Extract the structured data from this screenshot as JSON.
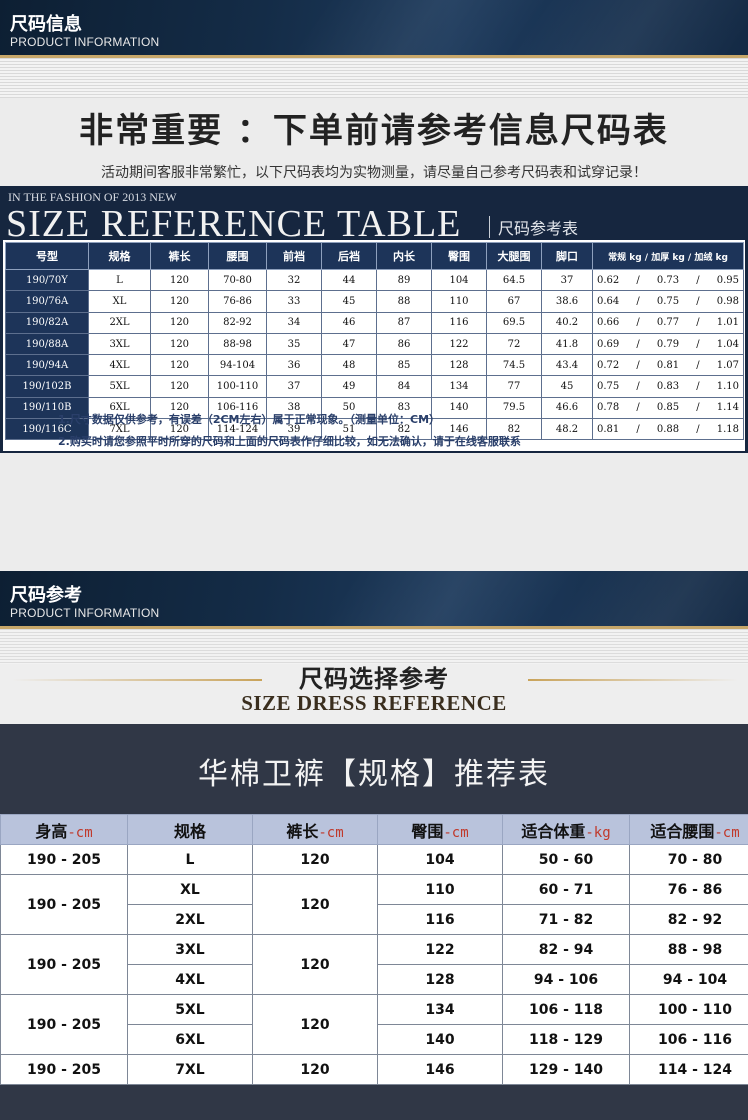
{
  "header1": {
    "cn": "尺码信息",
    "en": "PRODUCT INFORMATION"
  },
  "headline": "非常重要 ：下单前请参考信息尺码表",
  "subline": "活动期间客服非常繁忙，以下尺码表均为实物测量，请尽量自己参考尺码表和试穿记录！",
  "size_ref": {
    "fashion_line": "IN THE FASHION OF 2013 NEW",
    "title": "SIZE REFERENCE TABLE",
    "cn_title": "尺码参考表",
    "headers": [
      "号型",
      "规格",
      "裤长",
      "腰围",
      "前裆",
      "后裆",
      "内长",
      "臀围",
      "大腿围",
      "脚口",
      "常规 kg / 加厚 kg / 加绒 kg"
    ],
    "rows": [
      [
        "190/70Y",
        "L",
        "120",
        "70-80",
        "32",
        "44",
        "89",
        "104",
        "64.5",
        "37",
        "0.62",
        "0.73",
        "0.95"
      ],
      [
        "190/76A",
        "XL",
        "120",
        "76-86",
        "33",
        "45",
        "88",
        "110",
        "67",
        "38.6",
        "0.64",
        "0.75",
        "0.98"
      ],
      [
        "190/82A",
        "2XL",
        "120",
        "82-92",
        "34",
        "46",
        "87",
        "116",
        "69.5",
        "40.2",
        "0.66",
        "0.77",
        "1.01"
      ],
      [
        "190/88A",
        "3XL",
        "120",
        "88-98",
        "35",
        "47",
        "86",
        "122",
        "72",
        "41.8",
        "0.69",
        "0.79",
        "1.04"
      ],
      [
        "190/94A",
        "4XL",
        "120",
        "94-104",
        "36",
        "48",
        "85",
        "128",
        "74.5",
        "43.4",
        "0.72",
        "0.81",
        "1.07"
      ],
      [
        "190/102B",
        "5XL",
        "120",
        "100-110",
        "37",
        "49",
        "84",
        "134",
        "77",
        "45",
        "0.75",
        "0.83",
        "1.10"
      ],
      [
        "190/110B",
        "6XL",
        "120",
        "106-116",
        "38",
        "50",
        "83",
        "140",
        "79.5",
        "46.6",
        "0.78",
        "0.85",
        "1.14"
      ],
      [
        "190/116C",
        "7XL",
        "120",
        "114-124",
        "39",
        "51",
        "82",
        "146",
        "82",
        "48.2",
        "0.81",
        "0.88",
        "1.18"
      ]
    ]
  },
  "notes": [
    "1.尺寸数据仅供参考，有误差（2CM左右）属于正常现象。（测量单位：CM）",
    "2.购买时请您参照平时所穿的尺码和上面的尺码表作仔细比较，如无法确认，请于在线客服联系"
  ],
  "header2": {
    "cn": "尺码参考",
    "en": "PRODUCT INFORMATION"
  },
  "size_select": {
    "cn": "尺码选择参考",
    "en": "SIZE DRESS REFERENCE"
  },
  "recommend": {
    "title": "华棉卫裤【规格】推荐表",
    "headers": [
      {
        "label": "身高",
        "unit": "-cm"
      },
      {
        "label": "规格",
        "unit": ""
      },
      {
        "label": "裤长",
        "unit": "-cm"
      },
      {
        "label": "臀围",
        "unit": "-cm"
      },
      {
        "label": "适合体重",
        "unit": "-kg"
      },
      {
        "label": "适合腰围",
        "unit": "-cm"
      }
    ],
    "groups": [
      {
        "height": "190 - 205",
        "length": "120",
        "rows": [
          {
            "size": "L",
            "hip": "104",
            "weight": "50 - 60",
            "waist": "70 - 80"
          }
        ]
      },
      {
        "height": "190 - 205",
        "length": "120",
        "rows": [
          {
            "size": "XL",
            "hip": "110",
            "weight": "60 - 71",
            "waist": "76 - 86"
          },
          {
            "size": "2XL",
            "hip": "116",
            "weight": "71 - 82",
            "waist": "82 - 92"
          }
        ]
      },
      {
        "height": "190 - 205",
        "length": "120",
        "rows": [
          {
            "size": "3XL",
            "hip": "122",
            "weight": "82 - 94",
            "waist": "88 - 98"
          },
          {
            "size": "4XL",
            "hip": "128",
            "weight": "94 - 106",
            "waist": "94 - 104"
          }
        ]
      },
      {
        "height": "190 - 205",
        "length": "120",
        "rows": [
          {
            "size": "5XL",
            "hip": "134",
            "weight": "106 - 118",
            "waist": "100 - 110"
          },
          {
            "size": "6XL",
            "hip": "140",
            "weight": "118 - 129",
            "waist": "106 - 116"
          }
        ]
      },
      {
        "height": "190 - 205",
        "length": "120",
        "rows": [
          {
            "size": "7XL",
            "hip": "146",
            "weight": "129 - 140",
            "waist": "114 - 124"
          }
        ]
      }
    ]
  },
  "colors": {
    "navy": "#16263f",
    "header_blue": "#1d3459",
    "unit_red": "#c0392b",
    "gold": "#c9a35a",
    "panel": "#303746"
  }
}
